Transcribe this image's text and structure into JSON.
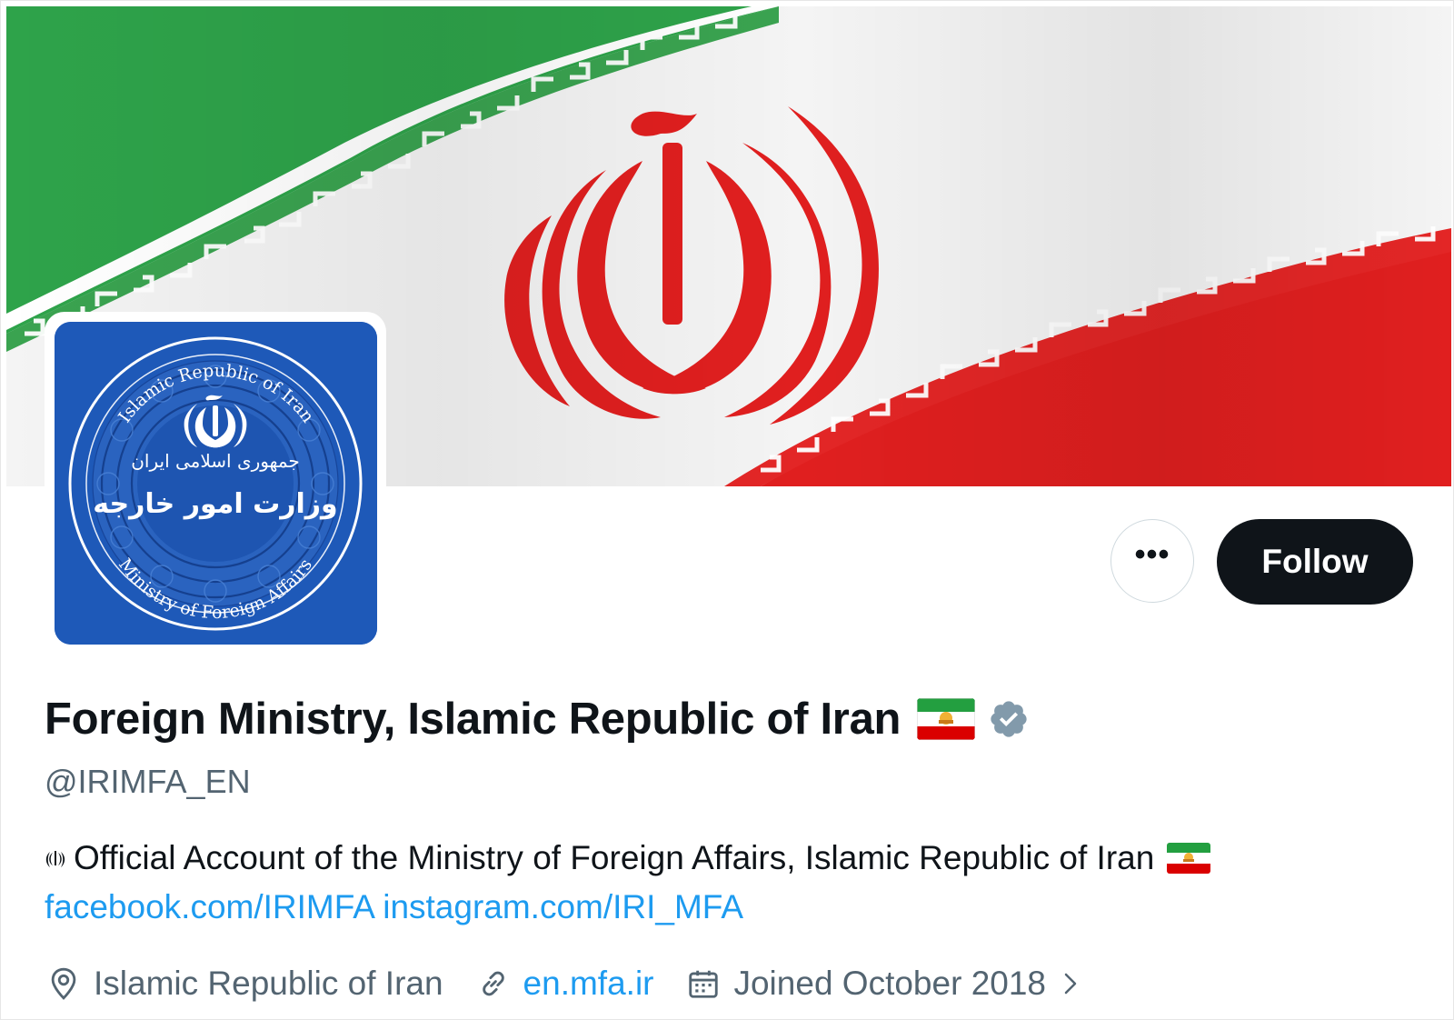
{
  "profile": {
    "display_name": "Foreign Ministry, Islamic Republic of Iran",
    "handle": "@IRIMFA_EN",
    "bio": "Official Account of the Ministry of Foreign Affairs, Islamic Republic of Iran",
    "links": [
      "facebook.com/IRIMFA",
      "instagram.com/IRI_MFA"
    ],
    "location": "Islamic Republic of Iran",
    "website": "en.mfa.ir",
    "joined": "Joined October 2018",
    "verified": true,
    "flag_emoji": "flag-iran-lion-sun"
  },
  "actions": {
    "more_label": "•••",
    "follow_label": "Follow"
  },
  "avatar": {
    "top_text": "Islamic Republic of Iran",
    "bottom_text": "Ministry of Foreign Affairs",
    "persian_line1": "جمهوری اسلامی ایران",
    "persian_line2": "وزارت امور خارجه",
    "background": "#1e59b8"
  },
  "colors": {
    "accent": "#1d9bf0",
    "text": "#0f1419",
    "secondary": "#536471",
    "flag_green": "#239f40",
    "flag_red": "#da0000",
    "verified": "#829aab"
  },
  "icons": {
    "location": "location-pin-icon",
    "link": "link-icon",
    "calendar": "calendar-icon",
    "chevron": "chevron-right-icon",
    "verified": "verified-badge-icon"
  }
}
